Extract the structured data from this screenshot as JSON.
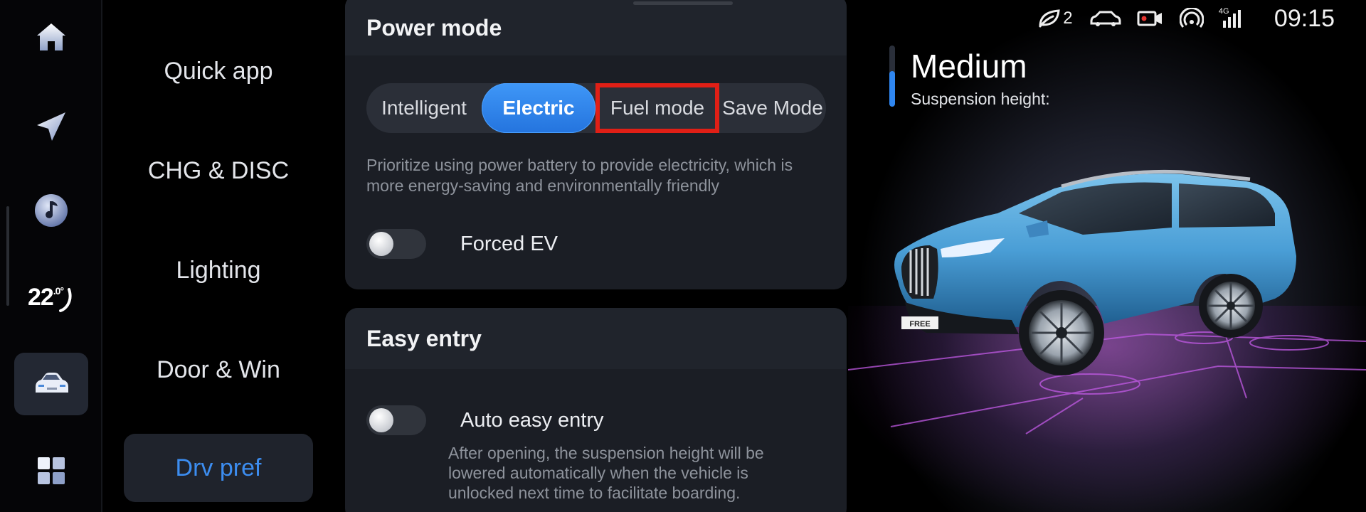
{
  "dock": {
    "temperature": "22",
    "temperature_unit": ".0°",
    "icons": [
      "home-icon",
      "navigation-icon",
      "music-icon",
      "seat-heat-icon",
      "car-icon",
      "apps-grid-icon"
    ]
  },
  "subnav": {
    "items": [
      {
        "label": "Quick app"
      },
      {
        "label": "CHG & DISC"
      },
      {
        "label": "Lighting"
      },
      {
        "label": "Door & Win"
      },
      {
        "label": "Drv pref"
      }
    ],
    "active": "Drv pref"
  },
  "power_mode": {
    "title": "Power mode",
    "options": [
      {
        "label": "Intelligent"
      },
      {
        "label": "Electric"
      },
      {
        "label": "Fuel mode"
      },
      {
        "label": "Save Mode"
      }
    ],
    "selected": "Electric",
    "description": "Prioritize using power battery to provide electricity, which is more energy-saving and environmentally friendly",
    "forced_ev_label": "Forced EV",
    "forced_ev_on": false
  },
  "easy_entry": {
    "title": "Easy entry",
    "auto_label": "Auto easy entry",
    "auto_on": false,
    "description": "After opening, the suspension height will be lowered automatically when the vehicle is unlocked next time to facilitate boarding."
  },
  "status_bar": {
    "eco_count": "2",
    "network": "4G",
    "time": "09:15"
  },
  "vehicle": {
    "suspension_level": "Medium",
    "suspension_label": "Suspension height:",
    "plate_text": "FREE",
    "body_color": "#4a9ed6",
    "accent_color": "#b84fd8"
  },
  "colors": {
    "accent": "#2f86f0",
    "highlight": "#e01f16"
  }
}
